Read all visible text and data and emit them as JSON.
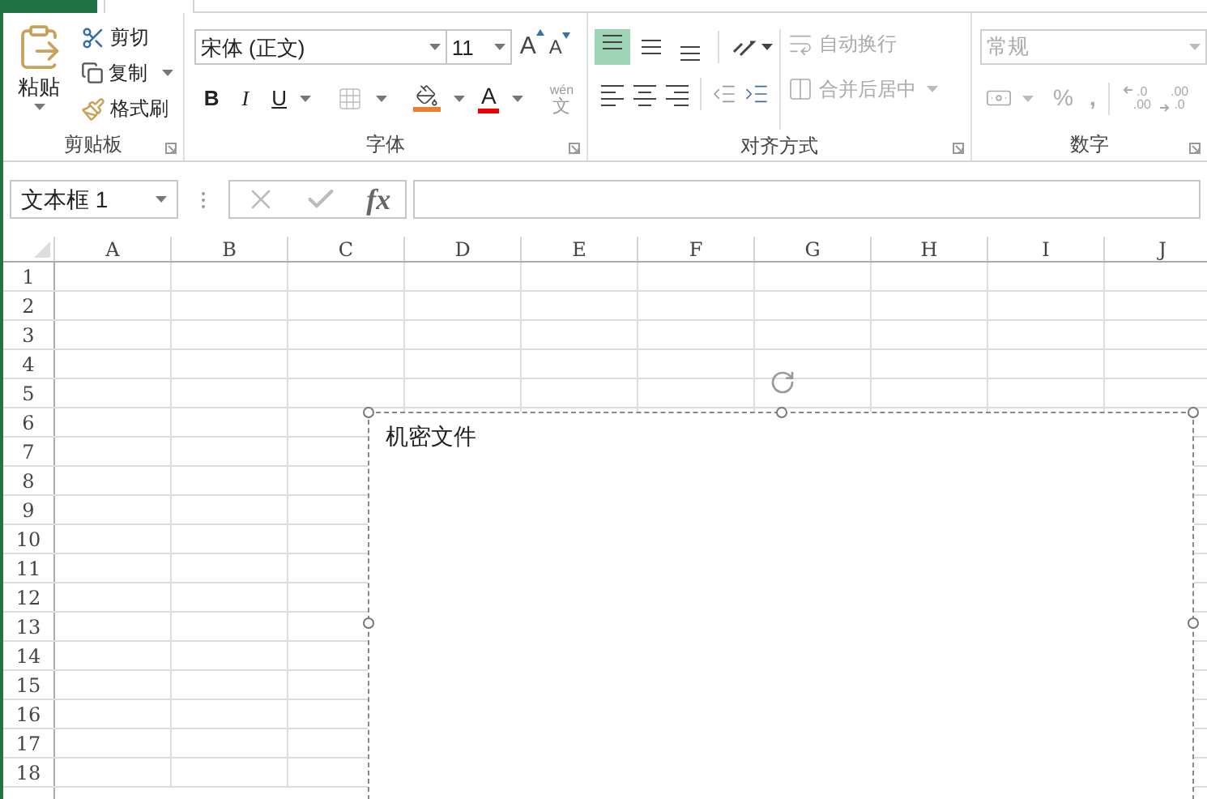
{
  "clipboard": {
    "paste": "粘贴",
    "cut": "剪切",
    "copy": "复制",
    "format_painter": "格式刷",
    "group_label": "剪贴板"
  },
  "font": {
    "font_name": "宋体 (正文)",
    "font_size": "11",
    "grow": "A",
    "shrink": "A",
    "bold": "B",
    "italic": "I",
    "underline": "U",
    "font_color": "A",
    "phonetic_top": "wén",
    "phonetic_bottom": "文",
    "group_label": "字体"
  },
  "alignment": {
    "vertical": [
      {
        "selected": true
      },
      {
        "selected": false
      },
      {
        "selected": false
      }
    ],
    "wrap_text": {
      "label": "自动换行",
      "disabled": true
    },
    "merge_center": {
      "label": "合并后居中",
      "disabled": true
    },
    "group_label": "对齐方式"
  },
  "number": {
    "format": "常规",
    "percent": "%",
    "comma": ",",
    "decimal_increase": {
      "top": ".0",
      "bottom": ".00"
    },
    "decimal_decrease": {
      "top": ".00",
      "bottom": ".0"
    },
    "disabled": true,
    "group_label": "数字"
  },
  "formula_bar": {
    "name_box": "文本框 1",
    "fx": "fx"
  },
  "sheet": {
    "columns": [
      "A",
      "B",
      "C",
      "D",
      "E",
      "F",
      "G",
      "H",
      "I",
      "J"
    ],
    "rows": [
      "1",
      "2",
      "3",
      "4",
      "5",
      "6",
      "7",
      "8",
      "9",
      "10",
      "11",
      "12",
      "13",
      "14",
      "15",
      "16",
      "17",
      "18"
    ]
  },
  "text_box": {
    "text": "机密文件"
  }
}
